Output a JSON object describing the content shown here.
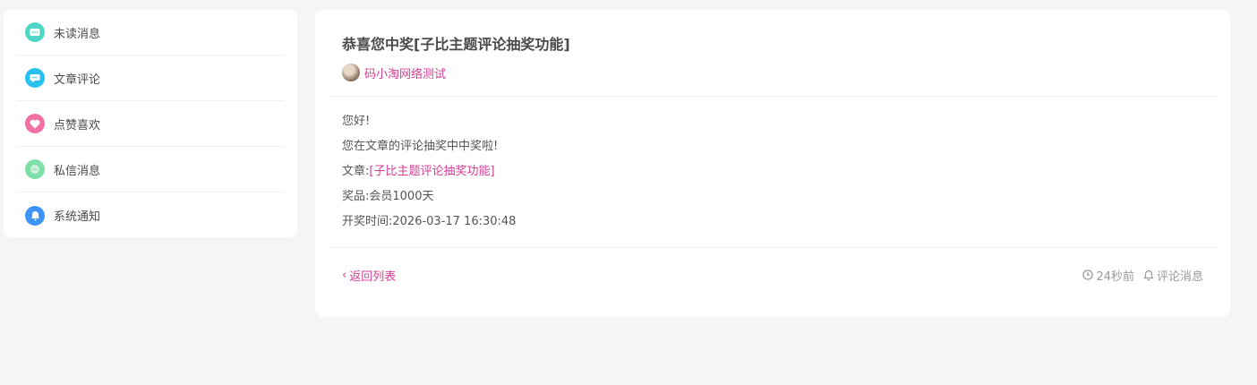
{
  "sidebar": {
    "items": [
      {
        "label": "未读消息",
        "icon": "message-dots-icon",
        "color": "#4fd7c5"
      },
      {
        "label": "文章评论",
        "icon": "comment-icon",
        "color": "#29c1f0"
      },
      {
        "label": "点赞喜欢",
        "icon": "heart-icon",
        "color": "#f171a4"
      },
      {
        "label": "私信消息",
        "icon": "chat-icon",
        "color": "#7fdfa9"
      },
      {
        "label": "系统通知",
        "icon": "bell-icon",
        "color": "#3e95f7"
      }
    ]
  },
  "message": {
    "title": "恭喜您中奖[子比主题评论抽奖功能]",
    "author": "码小淘网络测试",
    "greeting": "您好!",
    "intro": "您在文章的评论抽奖中中奖啦!",
    "article_label": "文章:",
    "article_link": "[子比主题评论抽奖功能]",
    "prize": "奖品:会员1000天",
    "draw_time": "开奖时间:2026-03-17 16:30:48"
  },
  "footer": {
    "back_label": "返回列表",
    "time_ago": "24秒前",
    "category": "评论消息"
  },
  "colors": {
    "accent": "#d63d94",
    "muted": "#999999",
    "background": "#f4f5f7"
  }
}
